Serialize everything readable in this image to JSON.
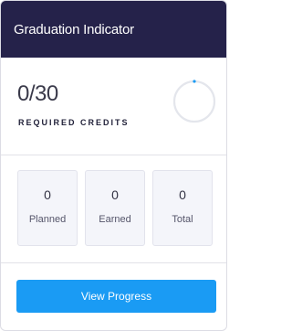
{
  "header": {
    "title": "Graduation Indicator"
  },
  "credits": {
    "count": "0/30",
    "label": "REQUIRED CREDITS",
    "progress_fraction": 0,
    "ring_track_color": "#e4e6ec",
    "ring_accent_color": "#1a9bf4"
  },
  "stats": [
    {
      "value": "0",
      "label": "Planned"
    },
    {
      "value": "0",
      "label": "Earned"
    },
    {
      "value": "0",
      "label": "Total"
    }
  ],
  "footer": {
    "button_label": "View Progress"
  },
  "colors": {
    "header_bg": "#25224a",
    "accent": "#1a9bf4"
  }
}
